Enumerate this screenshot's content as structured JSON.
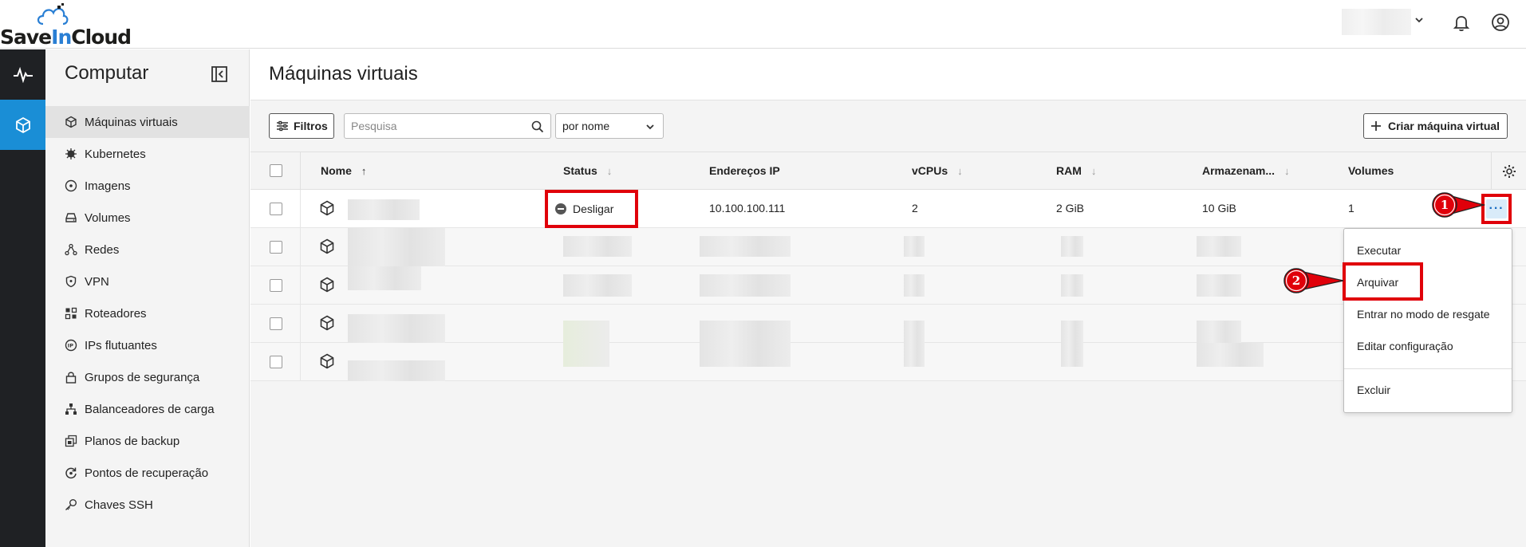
{
  "app": {
    "logo_save": "Save",
    "logo_in": "In",
    "logo_cloud": "Cloud"
  },
  "sidebar": {
    "title": "Computar",
    "items": [
      {
        "label": "Máquinas virtuais",
        "icon": "cube-icon"
      },
      {
        "label": "Kubernetes",
        "icon": "kubernetes-icon"
      },
      {
        "label": "Imagens",
        "icon": "disc-icon"
      },
      {
        "label": "Volumes",
        "icon": "drive-icon"
      },
      {
        "label": "Redes",
        "icon": "network-icon"
      },
      {
        "label": "VPN",
        "icon": "shield-icon"
      },
      {
        "label": "Roteadores",
        "icon": "router-icon"
      },
      {
        "label": "IPs flutuantes",
        "icon": "ip-icon"
      },
      {
        "label": "Grupos de segurança",
        "icon": "lock-icon"
      },
      {
        "label": "Balanceadores de carga",
        "icon": "balancer-icon"
      },
      {
        "label": "Planos de backup",
        "icon": "backup-icon"
      },
      {
        "label": "Pontos de recuperação",
        "icon": "restore-icon"
      },
      {
        "label": "Chaves SSH",
        "icon": "key-icon"
      }
    ]
  },
  "page": {
    "title": "Máquinas virtuais"
  },
  "toolbar": {
    "filter_label": "Filtros",
    "search_placeholder": "Pesquisa",
    "sort_value": "por nome",
    "create_label": "Criar máquina virtual"
  },
  "table": {
    "columns": [
      "Nome",
      "Status",
      "Endereços IP",
      "vCPUs",
      "RAM",
      "Armazenam...",
      "Volumes"
    ],
    "first_row": {
      "status": "Desligar",
      "ip": "10.100.100.111",
      "vcpus": "2",
      "ram": "2 GiB",
      "storage": "10 GiB",
      "volumes": "1",
      "more": "···"
    }
  },
  "context_menu": {
    "items": [
      "Executar",
      "Arquivar",
      "Entrar no modo de resgate",
      "Editar configuração",
      "Excluir"
    ]
  },
  "callouts": {
    "one": "1",
    "two": "2"
  },
  "colors": {
    "accent": "#1a8ed6",
    "highlight": "#e0000a",
    "rail": "#1f2124"
  }
}
